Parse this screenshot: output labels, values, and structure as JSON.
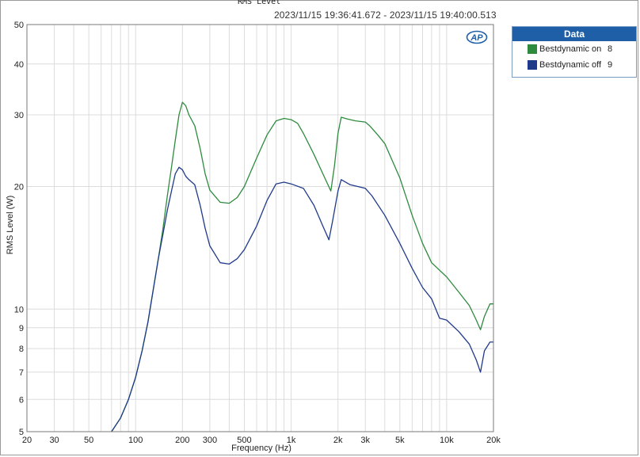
{
  "chart_data": {
    "type": "line",
    "title": "RMS Level",
    "subtitle": "2023/11/15 19:36:41.672 - 2023/11/15 19:40:00.513",
    "xlabel": "Frequency (Hz)",
    "ylabel": "RMS Level (W)",
    "x_scale": "log",
    "y_scale": "log",
    "xlim": [
      20,
      20000
    ],
    "ylim": [
      5,
      50
    ],
    "grid": true,
    "x_ticks": [
      20,
      30,
      50,
      100,
      200,
      300,
      500,
      1000,
      2000,
      3000,
      5000,
      10000,
      20000
    ],
    "x_tick_labels": [
      "20",
      "30",
      "50",
      "100",
      "200",
      "300",
      "500",
      "1k",
      "2k",
      "3k",
      "5k",
      "10k",
      "20k"
    ],
    "y_ticks": [
      5,
      6,
      7,
      8,
      9,
      10,
      20,
      30,
      40,
      50
    ],
    "y_tick_labels": [
      "5",
      "6",
      "7",
      "8",
      "9",
      "10",
      "20",
      "30",
      "40",
      "50"
    ],
    "legend": {
      "title": "Data",
      "position": "top-right outside"
    },
    "series": [
      {
        "name": "Bestdynamic on",
        "legend_number": "8",
        "color": "#2e8b3e",
        "points": [
          [
            70,
            5
          ],
          [
            80,
            5.4
          ],
          [
            90,
            6.0
          ],
          [
            100,
            6.8
          ],
          [
            110,
            7.9
          ],
          [
            120,
            9.3
          ],
          [
            130,
            11.2
          ],
          [
            140,
            13.3
          ],
          [
            150,
            15.8
          ],
          [
            160,
            19.0
          ],
          [
            170,
            22.3
          ],
          [
            180,
            26.0
          ],
          [
            190,
            30.0
          ],
          [
            200,
            32.2
          ],
          [
            210,
            31.6
          ],
          [
            220,
            30.0
          ],
          [
            240,
            28.2
          ],
          [
            260,
            24.8
          ],
          [
            280,
            21.5
          ],
          [
            300,
            19.6
          ],
          [
            350,
            18.3
          ],
          [
            400,
            18.2
          ],
          [
            450,
            18.8
          ],
          [
            500,
            20.0
          ],
          [
            600,
            23.5
          ],
          [
            700,
            26.8
          ],
          [
            800,
            29.0
          ],
          [
            900,
            29.4
          ],
          [
            1000,
            29.2
          ],
          [
            1100,
            28.6
          ],
          [
            1200,
            27.0
          ],
          [
            1400,
            24.0
          ],
          [
            1600,
            21.5
          ],
          [
            1800,
            19.5
          ],
          [
            1900,
            22.5
          ],
          [
            2000,
            27.0
          ],
          [
            2100,
            29.6
          ],
          [
            2300,
            29.3
          ],
          [
            2600,
            29.0
          ],
          [
            3000,
            28.8
          ],
          [
            3200,
            28.2
          ],
          [
            3600,
            26.8
          ],
          [
            4000,
            25.5
          ],
          [
            5000,
            21.0
          ],
          [
            6000,
            17.0
          ],
          [
            7000,
            14.5
          ],
          [
            8000,
            13.0
          ],
          [
            10000,
            12.0
          ],
          [
            12000,
            11.0
          ],
          [
            14000,
            10.2
          ],
          [
            15500,
            9.4
          ],
          [
            16500,
            8.9
          ],
          [
            17500,
            9.6
          ],
          [
            19000,
            10.3
          ],
          [
            20000,
            10.3
          ]
        ]
      },
      {
        "name": "Bestdynamic off",
        "legend_number": "9",
        "color": "#1f3a8a",
        "points": [
          [
            70,
            5
          ],
          [
            80,
            5.4
          ],
          [
            90,
            6.0
          ],
          [
            100,
            6.8
          ],
          [
            110,
            7.9
          ],
          [
            120,
            9.3
          ],
          [
            130,
            11.2
          ],
          [
            140,
            13.3
          ],
          [
            150,
            15.3
          ],
          [
            160,
            17.5
          ],
          [
            170,
            19.5
          ],
          [
            180,
            21.5
          ],
          [
            190,
            22.3
          ],
          [
            200,
            22.0
          ],
          [
            210,
            21.2
          ],
          [
            220,
            20.8
          ],
          [
            240,
            20.2
          ],
          [
            260,
            18.0
          ],
          [
            280,
            15.8
          ],
          [
            300,
            14.3
          ],
          [
            350,
            13.0
          ],
          [
            400,
            12.9
          ],
          [
            450,
            13.3
          ],
          [
            500,
            14.0
          ],
          [
            600,
            16.0
          ],
          [
            700,
            18.5
          ],
          [
            800,
            20.3
          ],
          [
            900,
            20.5
          ],
          [
            1000,
            20.3
          ],
          [
            1200,
            19.8
          ],
          [
            1400,
            18.0
          ],
          [
            1600,
            16.0
          ],
          [
            1750,
            14.8
          ],
          [
            1850,
            16.5
          ],
          [
            2000,
            19.5
          ],
          [
            2100,
            20.8
          ],
          [
            2400,
            20.2
          ],
          [
            3000,
            19.8
          ],
          [
            3300,
            19.0
          ],
          [
            4000,
            17.0
          ],
          [
            5000,
            14.5
          ],
          [
            6000,
            12.6
          ],
          [
            7000,
            11.3
          ],
          [
            8000,
            10.6
          ],
          [
            9000,
            9.5
          ],
          [
            10000,
            9.4
          ],
          [
            12000,
            8.8
          ],
          [
            14000,
            8.2
          ],
          [
            15500,
            7.5
          ],
          [
            16500,
            7.0
          ],
          [
            17500,
            7.9
          ],
          [
            19000,
            8.3
          ],
          [
            20000,
            8.3
          ]
        ]
      }
    ]
  },
  "legend": {
    "header": "Data",
    "items": [
      {
        "label": "Bestdynamic on",
        "number": "8",
        "color": "#2e8b3e"
      },
      {
        "label": "Bestdynamic off",
        "number": "9",
        "color": "#1f3a8a"
      }
    ]
  },
  "logo_text": "AP"
}
